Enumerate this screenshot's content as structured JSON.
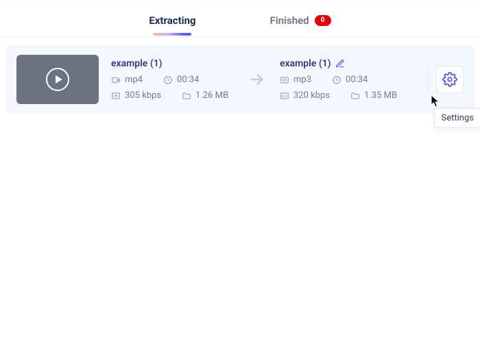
{
  "tabs": {
    "extracting": "Extracting",
    "finished": "Finished",
    "finished_count": "0"
  },
  "item": {
    "source": {
      "name": "example (1)",
      "format": "mp4",
      "duration": "00:34",
      "bitrate": "305 kbps",
      "size": "1.26 MB"
    },
    "target": {
      "name": "example (1)",
      "format": "mp3",
      "duration": "00:34",
      "bitrate": "320 kbps",
      "size": "1.35 MB"
    }
  },
  "tooltip": {
    "settings": "Settings"
  },
  "colors": {
    "accent": "#5457ec",
    "badge": "#e7000b",
    "filename": "#2a3b8f",
    "muted": "#747a8b"
  }
}
